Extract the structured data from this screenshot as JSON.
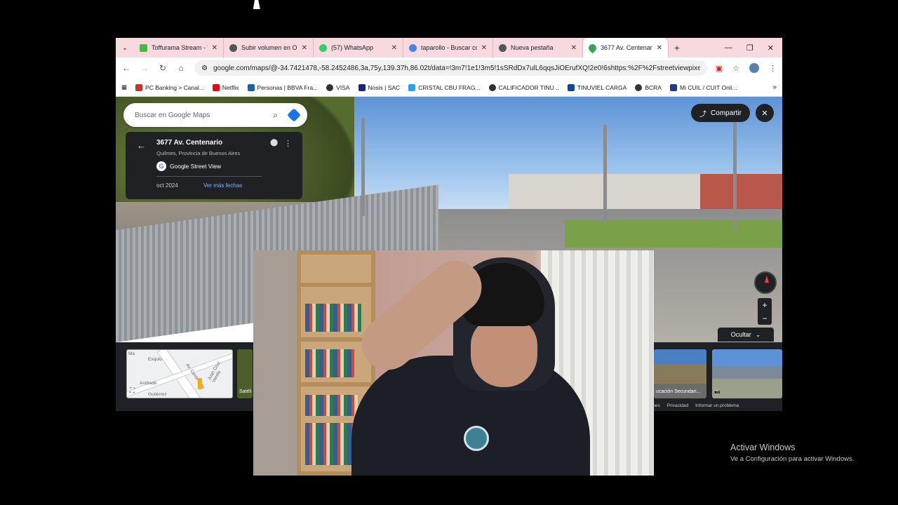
{
  "browser": {
    "tabs": [
      {
        "label": "Toffurama Stream - V",
        "color": "#3fbf3f"
      },
      {
        "label": "Subir volumen en OB",
        "color": "#555555"
      },
      {
        "label": "(57) WhatsApp",
        "color": "#25d366"
      },
      {
        "label": "taparollo - Buscar co",
        "color": "#4285f4"
      },
      {
        "label": "Nueva pestaña",
        "color": "#555555"
      },
      {
        "label": "3677 Av. Centenario",
        "color": "#34a853"
      }
    ],
    "url": "google.com/maps/@-34.7421478,-58.2452486,3a,75y,139.37h,86.02t/data=!3m7!1e1!3m5!1sSRdDx7ulL6qqsJiOErufXQ!2e0!6shttps:%2F%2Fstreetviewpixels-pa.go...",
    "bookmarks": [
      {
        "label": "PC Banking > Canal...",
        "color": "#c0392b"
      },
      {
        "label": "Netflix",
        "color": "#e50914"
      },
      {
        "label": "Personas | BBVA Fra...",
        "color": "#1464a5"
      },
      {
        "label": "VISA",
        "color": "#333333"
      },
      {
        "label": "Nosis | SAC",
        "color": "#1a237e"
      },
      {
        "label": "CRISTAL CBU FRAG...",
        "color": "#2a9df4"
      },
      {
        "label": "CALIFICADOR TINU...",
        "color": "#333333"
      },
      {
        "label": "TINUVIEL CARGA",
        "color": "#0d47a1"
      },
      {
        "label": "BCRA",
        "color": "#333333"
      },
      {
        "label": "Mi CUIL / CUIT Onli...",
        "color": "#1e3a8a"
      }
    ]
  },
  "maps": {
    "search_placeholder": "Buscar en Google Maps",
    "place_title": "3677 Av. Centenario",
    "place_subtitle": "Quilmes, Provincia de Buenos Aires",
    "source": "Google Street View",
    "date": "oct 2024",
    "more_dates": "Ver más fechas",
    "share": "Compartir",
    "hide": "Ocultar",
    "minimap_streets": [
      "Esquiú",
      "Av. Centenario",
      "Juan Cruz Varela",
      "Andrade",
      "Gutiérrez",
      "Ma"
    ],
    "thumbs": [
      "Satéli",
      "ucación Secundari..."
    ],
    "footer": [
      "Condiciones",
      "Privacidad",
      "Informar un problema"
    ]
  },
  "overlay": {
    "activate_title": "Activar Windows",
    "activate_sub": "Ve a Configuración para activar Windows."
  }
}
